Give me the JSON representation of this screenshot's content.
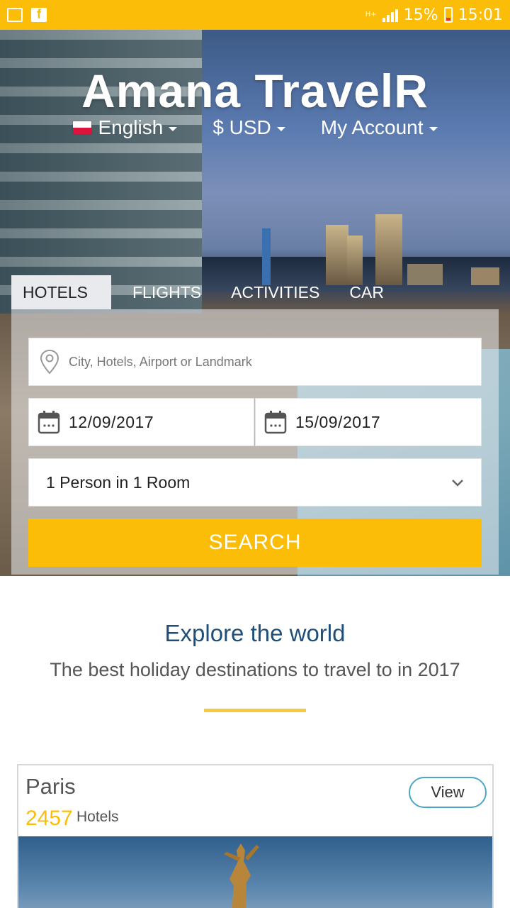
{
  "status_bar": {
    "battery": "15%",
    "time": "15:01",
    "network": "H+"
  },
  "header": {
    "logo": "Amana TravelR",
    "language": "English",
    "currency": "$ USD",
    "account": "My Account"
  },
  "tabs": [
    {
      "label": "HOTELS",
      "active": true
    },
    {
      "label": "FLIGHTS",
      "active": false
    },
    {
      "label": "ACTIVITIES",
      "active": false
    },
    {
      "label": "CAR",
      "active": false
    }
  ],
  "search": {
    "location_placeholder": "City, Hotels, Airport or Landmark",
    "checkin": "12/09/2017",
    "checkout": "15/09/2017",
    "guests": "1 Person in 1 Room",
    "button": "SEARCH"
  },
  "explore": {
    "title": "Explore the world",
    "subtitle": "The best holiday destinations to travel to in 2017"
  },
  "destinations": [
    {
      "city": "Paris",
      "count": "2457",
      "label": "Hotels",
      "button": "View"
    }
  ],
  "colors": {
    "accent": "#fbbd08",
    "title_blue": "#1f4e79",
    "view_border": "#4ea6c6"
  }
}
